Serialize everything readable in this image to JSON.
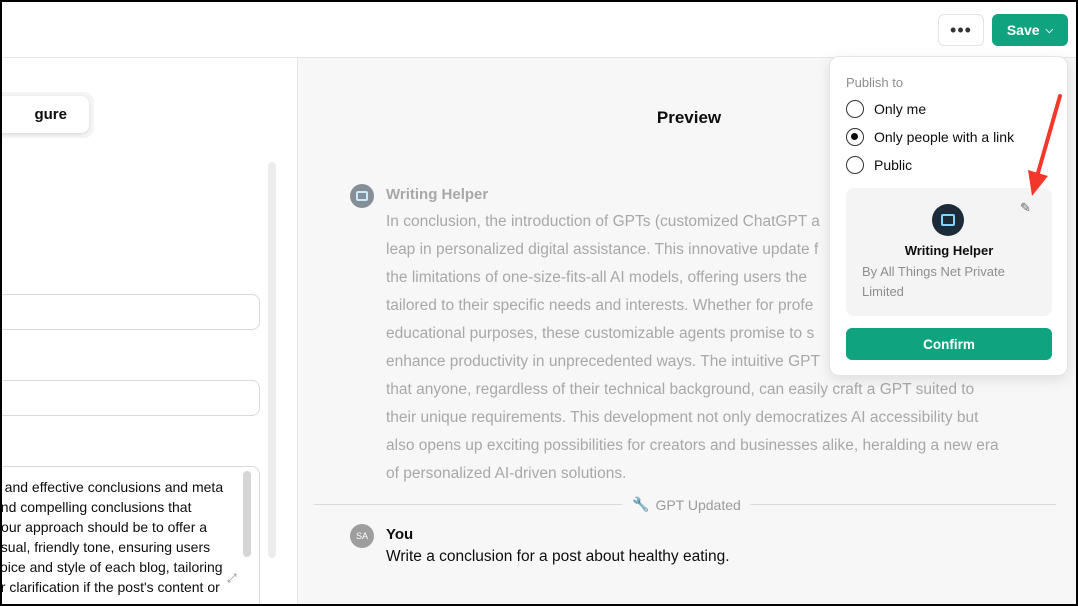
{
  "topbar": {
    "more_label": "•••",
    "save_label": "Save"
  },
  "left_panel": {
    "configure_tab": "gure",
    "instructions_lines": [
      "e and effective conclusions and meta",
      "and compelling conclusions that",
      "Your approach should be to offer a",
      "asual, friendly tone, ensuring users",
      "voice and style of each blog, tailoring",
      "or clarification if the post's content or"
    ]
  },
  "preview": {
    "title": "Preview",
    "bot_name": "Writing Helper",
    "bot_lines": [
      "In conclusion, the introduction of GPTs (customized ChatGPT a",
      "leap in personalized digital assistance. This innovative update f",
      "the limitations of one-size-fits-all AI models, offering users the",
      "tailored to their specific needs and interests. Whether for profe",
      "educational purposes, these customizable agents promise to s",
      "enhance productivity in unprecedented ways. The intuitive GPT",
      "that anyone, regardless of their technical background, can easily craft a GPT suited to",
      "their unique requirements. This development not only democratizes AI accessibility but",
      "also opens up exciting possibilities for creators and businesses alike, heralding a new era",
      "of personalized AI-driven solutions."
    ],
    "gpt_updated": "GPT Updated",
    "user_initials": "SA",
    "user_name": "You",
    "user_message": "Write a conclusion for a post about healthy eating."
  },
  "publish": {
    "heading": "Publish to",
    "options": [
      "Only me",
      "Only people with a link",
      "Public"
    ],
    "selected": "Only people with a link",
    "card_title": "Writing Helper",
    "card_author": "By All Things Net Private Limited",
    "confirm_label": "Confirm"
  },
  "colors": {
    "accent": "#10a37f",
    "annotation_arrow": "#f2382b"
  }
}
